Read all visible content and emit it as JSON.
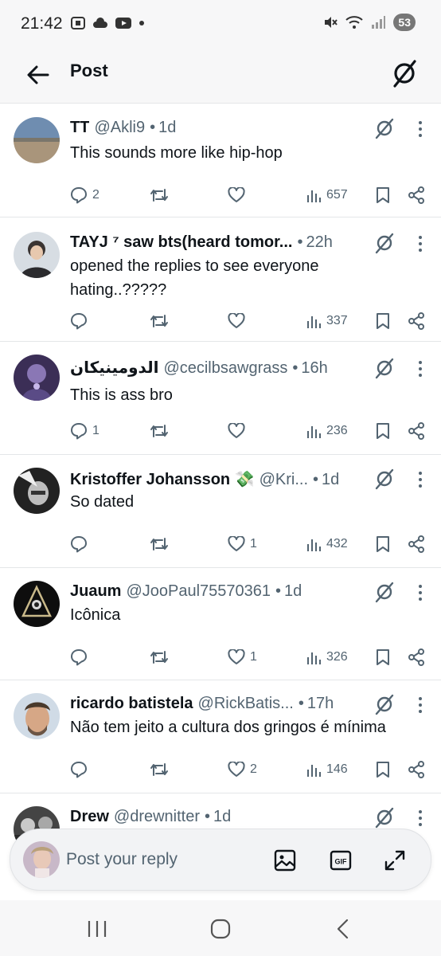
{
  "status": {
    "time": "21:42",
    "battery": "53"
  },
  "header": {
    "title": "Post"
  },
  "posts": [
    {
      "author": "TT",
      "handle": "@Akli9",
      "time": "1d",
      "text": "This sounds more like hip-hop",
      "replies": "2",
      "reposts": "",
      "likes": "",
      "views": "657"
    },
    {
      "author": "TAYJ ⁷ saw bts(heard tomor...",
      "handle": "",
      "time": "22h",
      "text": "opened the replies to see everyone hating..?????",
      "replies": "",
      "reposts": "",
      "likes": "",
      "views": "337"
    },
    {
      "author": "الدومينيكان",
      "handle": "@cecilbsawgrass",
      "time": "16h",
      "text": "This is ass bro",
      "replies": "1",
      "reposts": "",
      "likes": "",
      "views": "236"
    },
    {
      "author": "Kristoffer Johansson 💸",
      "handle": "@Kri...",
      "time": "1d",
      "text": "So dated",
      "replies": "",
      "reposts": "",
      "likes": "1",
      "views": "432"
    },
    {
      "author": "Juaum",
      "handle": "@JooPaul75570361",
      "time": "1d",
      "text": "Icônica",
      "replies": "",
      "reposts": "",
      "likes": "1",
      "views": "326"
    },
    {
      "author": "ricardo batistela",
      "handle": "@RickBatis...",
      "time": "17h",
      "text": "Não tem jeito a cultura dos gringos é mínima",
      "replies": "",
      "reposts": "",
      "likes": "2",
      "views": "146"
    },
    {
      "author": "Drew",
      "handle": "@drewnitter",
      "time": "1d",
      "text": "",
      "replies": "",
      "reposts": "",
      "likes": "",
      "views": ""
    }
  ],
  "reply": {
    "placeholder": "Post your reply"
  },
  "colors": {
    "text": "#0f1419",
    "secondary": "#536471",
    "divider": "#e4e6e8"
  }
}
